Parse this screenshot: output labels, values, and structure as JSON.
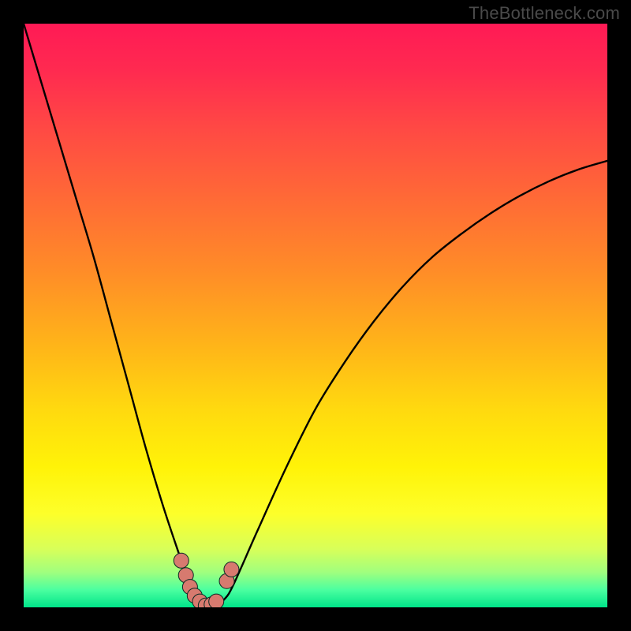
{
  "watermark": {
    "text": "TheBottleneck.com"
  },
  "colors": {
    "background": "#000000",
    "curve": "#000000",
    "marker": "#d77a6f",
    "marker_edge": "#0a2a24",
    "gradient_top": "#ff1a55",
    "gradient_bottom": "#00e58a"
  },
  "chart_data": {
    "type": "line",
    "title": "",
    "xlabel": "",
    "ylabel": "",
    "xlim": [
      0,
      100
    ],
    "ylim": [
      0,
      100
    ],
    "grid": false,
    "series": [
      {
        "name": "bottleneck-curve",
        "x": [
          0,
          3,
          6,
          9,
          12,
          15,
          18,
          21,
          24,
          27,
          28.5,
          30,
          31.5,
          33,
          34.5,
          36,
          40,
          45,
          50,
          55,
          60,
          65,
          70,
          75,
          80,
          85,
          90,
          95,
          100
        ],
        "values": [
          100,
          90,
          80,
          70,
          60,
          49,
          38,
          27,
          17,
          8,
          3.5,
          1.2,
          0.2,
          0.5,
          1.5,
          4,
          13,
          24,
          34,
          42,
          49,
          55,
          60,
          64,
          67.5,
          70.5,
          73,
          75,
          76.5
        ]
      }
    ],
    "markers": [
      {
        "name": "left-cluster-start",
        "x": 27.0,
        "y": 8.0
      },
      {
        "name": "left-cluster-a",
        "x": 27.8,
        "y": 5.5
      },
      {
        "name": "left-cluster-b",
        "x": 28.5,
        "y": 3.5
      },
      {
        "name": "left-cluster-c",
        "x": 29.3,
        "y": 2.0
      },
      {
        "name": "valley-left",
        "x": 30.2,
        "y": 1.0
      },
      {
        "name": "valley-min",
        "x": 31.2,
        "y": 0.3
      },
      {
        "name": "valley-right",
        "x": 32.2,
        "y": 0.5
      },
      {
        "name": "valley-right-b",
        "x": 33.0,
        "y": 1.0
      },
      {
        "name": "right-cluster-a",
        "x": 34.8,
        "y": 4.5
      },
      {
        "name": "right-cluster-b",
        "x": 35.6,
        "y": 6.5
      }
    ],
    "annotations": []
  }
}
